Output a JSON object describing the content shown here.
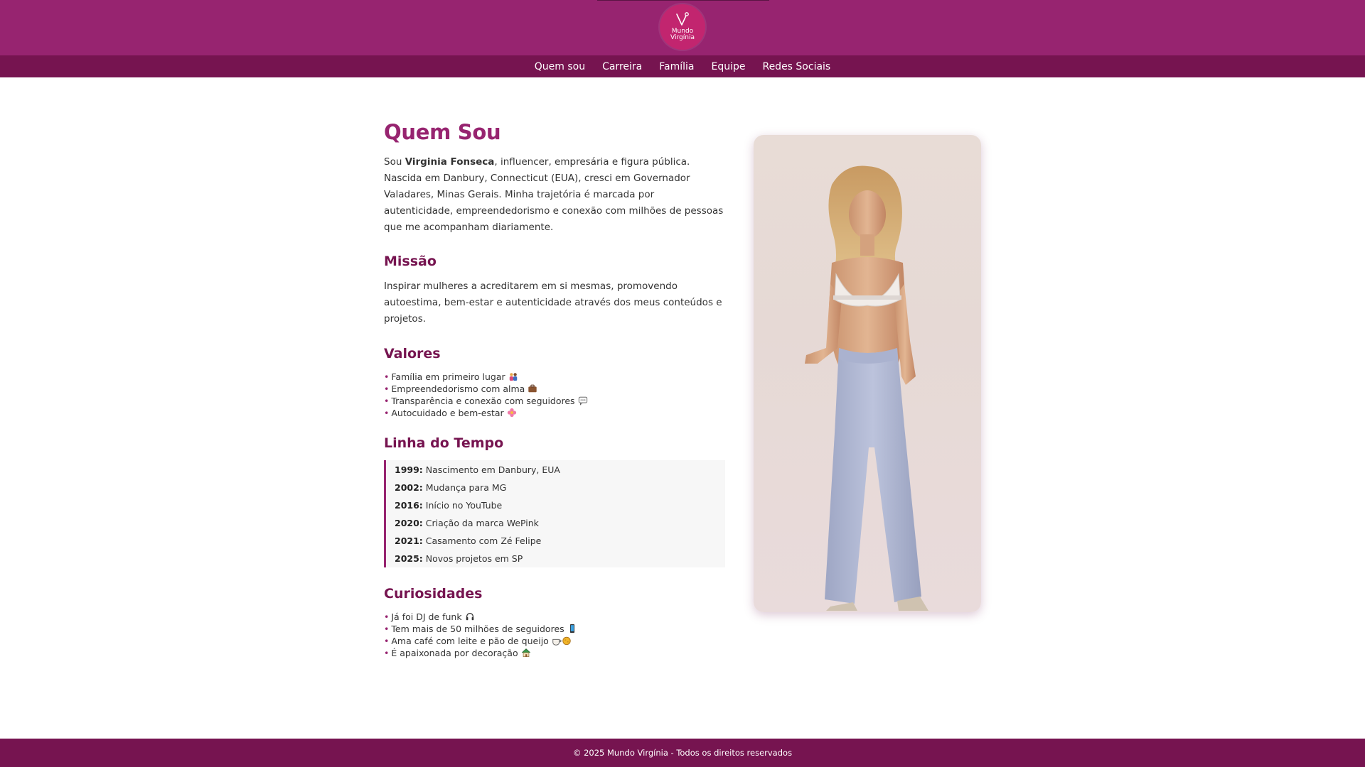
{
  "header": {
    "logo_line1": "Mundo",
    "logo_line2": "Virgínia",
    "brand_color": "#972470",
    "nav_color": "#761450"
  },
  "nav": {
    "items": [
      {
        "label": "Quem sou"
      },
      {
        "label": "Carreira"
      },
      {
        "label": "Família"
      },
      {
        "label": "Equipe"
      },
      {
        "label": "Redes Sociais"
      }
    ]
  },
  "about": {
    "title": "Quem Sou",
    "intro_prefix": "Sou ",
    "intro_name": "Virginia Fonseca",
    "intro_rest": ", influencer, empresária e figura pública. Nascida em Danbury, Connecticut (EUA), cresci em Governador Valadares, Minas Gerais. Minha trajetória é marcada por autenticidade, empreendedorismo e conexão com milhões de pessoas que me acompanham diariamente.",
    "mission_title": "Missão",
    "mission_text": "Inspirar mulheres a acreditarem em si mesmas, promovendo autoestima, bem-estar e autenticidade através dos meus conteúdos e projetos.",
    "values_title": "Valores",
    "values": [
      {
        "text": "Família em primeiro lugar",
        "icon": "family-icon"
      },
      {
        "text": "Empreendedorismo com alma",
        "icon": "briefcase-icon"
      },
      {
        "text": "Transparência e conexão com seguidores",
        "icon": "speech-bubble-icon"
      },
      {
        "text": "Autocuidado e bem-estar",
        "icon": "flower-icon"
      }
    ],
    "timeline_title": "Linha do Tempo",
    "timeline": [
      {
        "year": "1999:",
        "event": "Nascimento em Danbury, EUA"
      },
      {
        "year": "2002:",
        "event": "Mudança para MG"
      },
      {
        "year": "2016:",
        "event": "Início no YouTube"
      },
      {
        "year": "2020:",
        "event": "Criação da marca WePink"
      },
      {
        "year": "2021:",
        "event": "Casamento com Zé Felipe"
      },
      {
        "year": "2025:",
        "event": "Novos projetos em SP"
      }
    ],
    "curiosities_title": "Curiosidades",
    "curiosities": [
      {
        "text": "Já foi DJ de funk",
        "icon": "headphones-icon"
      },
      {
        "text": "Tem mais de 50 milhões de seguidores",
        "icon": "phone-icon"
      },
      {
        "text": "Ama café com leite e pão de queijo",
        "icon": "coffee-and-bread-icon"
      },
      {
        "text": "É apaixonada por decoração",
        "icon": "house-icon"
      }
    ]
  },
  "footer": {
    "text": "© 2025 Mundo Virgínia - Todos os direitos reservados"
  }
}
